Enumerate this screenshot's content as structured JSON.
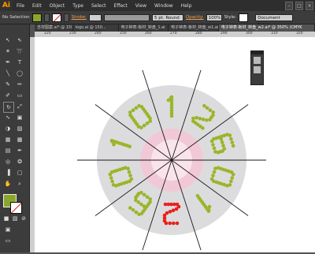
{
  "app": {
    "logo": "Ai"
  },
  "menu": [
    "File",
    "Edit",
    "Object",
    "Type",
    "Select",
    "Effect",
    "View",
    "Window",
    "Help"
  ],
  "window_buttons": [
    "–",
    "□",
    "×"
  ],
  "controlbar": {
    "selection_label": "No Selection",
    "stroke_label": "Stroke:",
    "stroke_profile": "5 pt. Round",
    "opacity_label": "Opacity:",
    "opacity_value": "100%",
    "style_label": "Style:",
    "doc_setup": "Document Setup"
  },
  "tabs": [
    {
      "label": "吉祥图案.ai* @ 150%",
      "active": false
    },
    {
      "label": "logo.ai @ 150...",
      "active": false
    },
    {
      "label": "电子钟表-板材_转盘_1.ai",
      "active": false
    },
    {
      "label": "电子钟表-板材_转盘_w1.ai*",
      "active": false
    },
    {
      "label": "电子钟表-板材_转盘_w2.ai* @ 350% (CMYK",
      "active": true
    }
  ],
  "ruler": [
    "220",
    "230",
    "240",
    "250",
    "260",
    "270",
    "280",
    "290",
    "300",
    "310",
    "320"
  ],
  "colors": {
    "fill": "#8ba62a",
    "stroke_none": "#e02020",
    "dot_green": "#9ab52a",
    "dot_red": "#e8201c"
  }
}
